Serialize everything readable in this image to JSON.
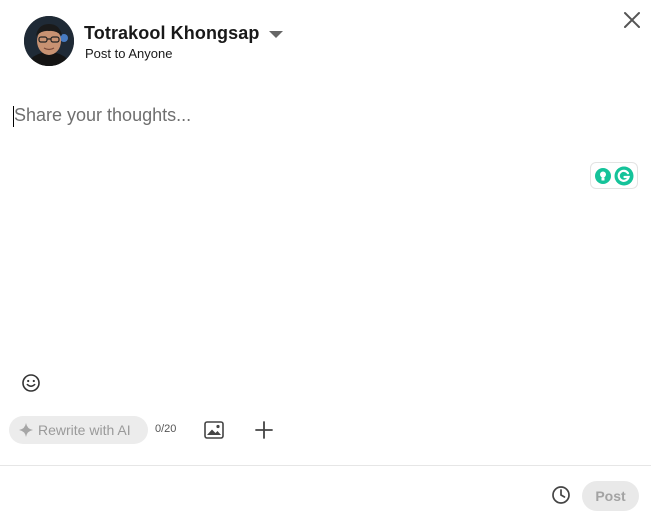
{
  "header": {
    "author_name": "Totrakool Khongsap",
    "audience_label": "Post to Anyone",
    "close_icon": "close-icon",
    "dropdown_icon": "caret-down-icon"
  },
  "editor": {
    "placeholder": "Share your thoughts...",
    "value": ""
  },
  "toolbar": {
    "rewrite_label": "Rewrite with AI",
    "char_counter": "0/20",
    "icons": [
      "emoji-icon",
      "sparkle-icon",
      "image-icon",
      "plus-icon"
    ]
  },
  "footer": {
    "post_label": "Post",
    "schedule_icon": "clock-icon"
  },
  "colors": {
    "grammarly_green": "#15C39A",
    "disabled_text": "#a3a3a3",
    "disabled_bg": "#e9e9e9"
  }
}
